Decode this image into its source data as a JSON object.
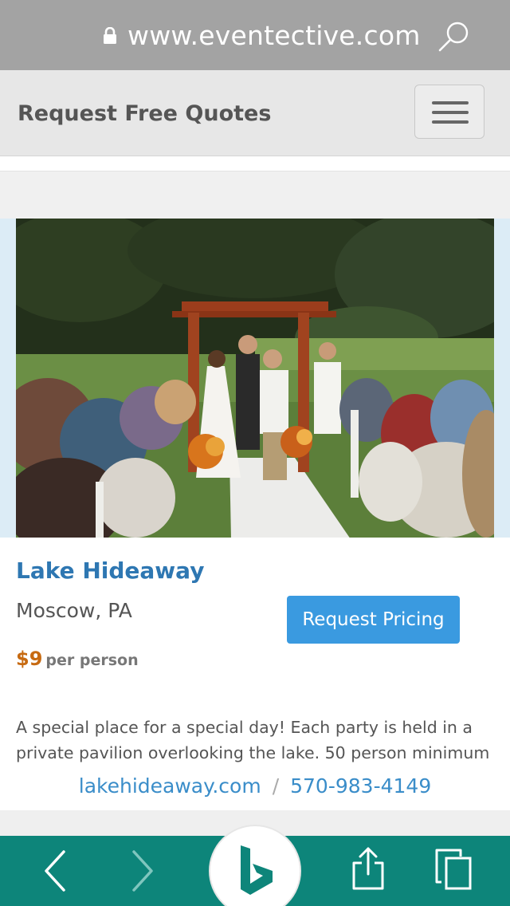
{
  "browser": {
    "url": "www.eventective.com",
    "lock_icon": "lock-icon",
    "search_icon": "search-icon"
  },
  "site": {
    "header_title": "Request Free Quotes",
    "menu_icon": "hamburger-menu-icon"
  },
  "venue": {
    "name": "Lake Hideaway",
    "location": "Moscow, PA",
    "pricing_button": "Request Pricing",
    "price": "$9",
    "price_unit": "per person",
    "description": "A special place for a special day! Each party is held in a private pavilion overlooking the lake. 50 person minimum",
    "website": "lakehideaway.com",
    "separator": "/",
    "phone": "570-983-4149"
  },
  "toolbar": {
    "back_icon": "chevron-left-icon",
    "forward_icon": "chevron-right-icon",
    "bing_icon": "bing-logo-icon",
    "share_icon": "share-icon",
    "tabs_icon": "tabs-icon"
  },
  "colors": {
    "accent_blue": "#2e77b2",
    "button_blue": "#3a9ae0",
    "price_orange": "#c76a11",
    "toolbar_teal": "#0d857a"
  }
}
